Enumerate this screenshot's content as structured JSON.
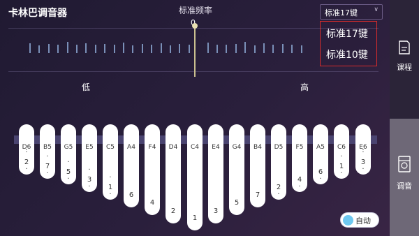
{
  "header": {
    "app_title": "卡林巴调音器",
    "freq_title": "标准频率"
  },
  "mode_select": {
    "value": "标准17键",
    "options": [
      "标准17键",
      "标准10键"
    ]
  },
  "meter": {
    "zero_label": "0",
    "low_label": "低",
    "high_label": "高"
  },
  "keys": [
    {
      "note": "D6",
      "degree": "2"
    },
    {
      "note": "B5",
      "degree": "7"
    },
    {
      "note": "G5",
      "degree": "5"
    },
    {
      "note": "E5",
      "degree": "3"
    },
    {
      "note": "C5",
      "degree": "1"
    },
    {
      "note": "A4",
      "degree": "6"
    },
    {
      "note": "F4",
      "degree": "4"
    },
    {
      "note": "D4",
      "degree": "2"
    },
    {
      "note": "C4",
      "degree": "1"
    },
    {
      "note": "E4",
      "degree": "3"
    },
    {
      "note": "G4",
      "degree": "5"
    },
    {
      "note": "B4",
      "degree": "7"
    },
    {
      "note": "D5",
      "degree": "2"
    },
    {
      "note": "F5",
      "degree": "4"
    },
    {
      "note": "A5",
      "degree": "6"
    },
    {
      "note": "C6",
      "degree": "1"
    },
    {
      "note": "E6",
      "degree": "3"
    }
  ],
  "auto": {
    "label": "自动",
    "enabled": true
  },
  "sidebar": {
    "items": [
      {
        "label": "课程",
        "icon": "course-icon"
      },
      {
        "label": "调音",
        "icon": "tuner-icon",
        "active": true
      }
    ]
  },
  "colors": {
    "accent_toggle": "#6ec8f0",
    "highlight_border": "#d82c2c",
    "tick": "#7a90b8",
    "needle": "#c9bf8e"
  }
}
